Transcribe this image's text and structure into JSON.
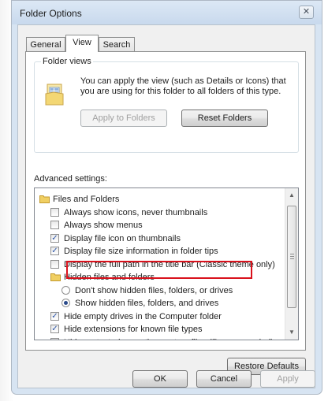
{
  "window": {
    "title": "Folder Options"
  },
  "tabs": [
    {
      "label": "General",
      "active": false
    },
    {
      "label": "View",
      "active": true
    },
    {
      "label": "Search",
      "active": false
    }
  ],
  "folder_views": {
    "label": "Folder views",
    "description": "You can apply the view (such as Details or Icons) that you are using for this folder to all folders of this type.",
    "apply_button": "Apply to Folders",
    "reset_button": "Reset Folders"
  },
  "advanced": {
    "label": "Advanced settings:",
    "items": [
      {
        "type": "folder",
        "text": "Files and Folders",
        "indent": 0
      },
      {
        "type": "checkbox",
        "text": "Always show icons, never thumbnails",
        "checked": false,
        "indent": 1
      },
      {
        "type": "checkbox",
        "text": "Always show menus",
        "checked": false,
        "indent": 1
      },
      {
        "type": "checkbox",
        "text": "Display file icon on thumbnails",
        "checked": true,
        "indent": 1
      },
      {
        "type": "checkbox",
        "text": "Display file size information in folder tips",
        "checked": true,
        "indent": 1
      },
      {
        "type": "checkbox",
        "text": "Display the full path in the title bar (Classic theme only)",
        "checked": false,
        "indent": 1
      },
      {
        "type": "folder",
        "text": "Hidden files and folders",
        "indent": 1
      },
      {
        "type": "radio",
        "text": "Don't show hidden files, folders, or drives",
        "checked": false,
        "indent": 2
      },
      {
        "type": "radio",
        "text": "Show hidden files, folders, and drives",
        "checked": true,
        "indent": 2
      },
      {
        "type": "checkbox",
        "text": "Hide empty drives in the Computer folder",
        "checked": true,
        "indent": 1
      },
      {
        "type": "checkbox",
        "text": "Hide extensions for known file types",
        "checked": true,
        "indent": 1
      },
      {
        "type": "checkbox",
        "text": "Hide protected operating system files (Recommended)",
        "checked": false,
        "indent": 1
      }
    ],
    "restore_button": "Restore Defaults"
  },
  "footer": {
    "ok": "OK",
    "cancel": "Cancel",
    "apply": "Apply"
  },
  "colors": {
    "highlight": "#d9111c",
    "window_frame": "#d7e4f2"
  }
}
